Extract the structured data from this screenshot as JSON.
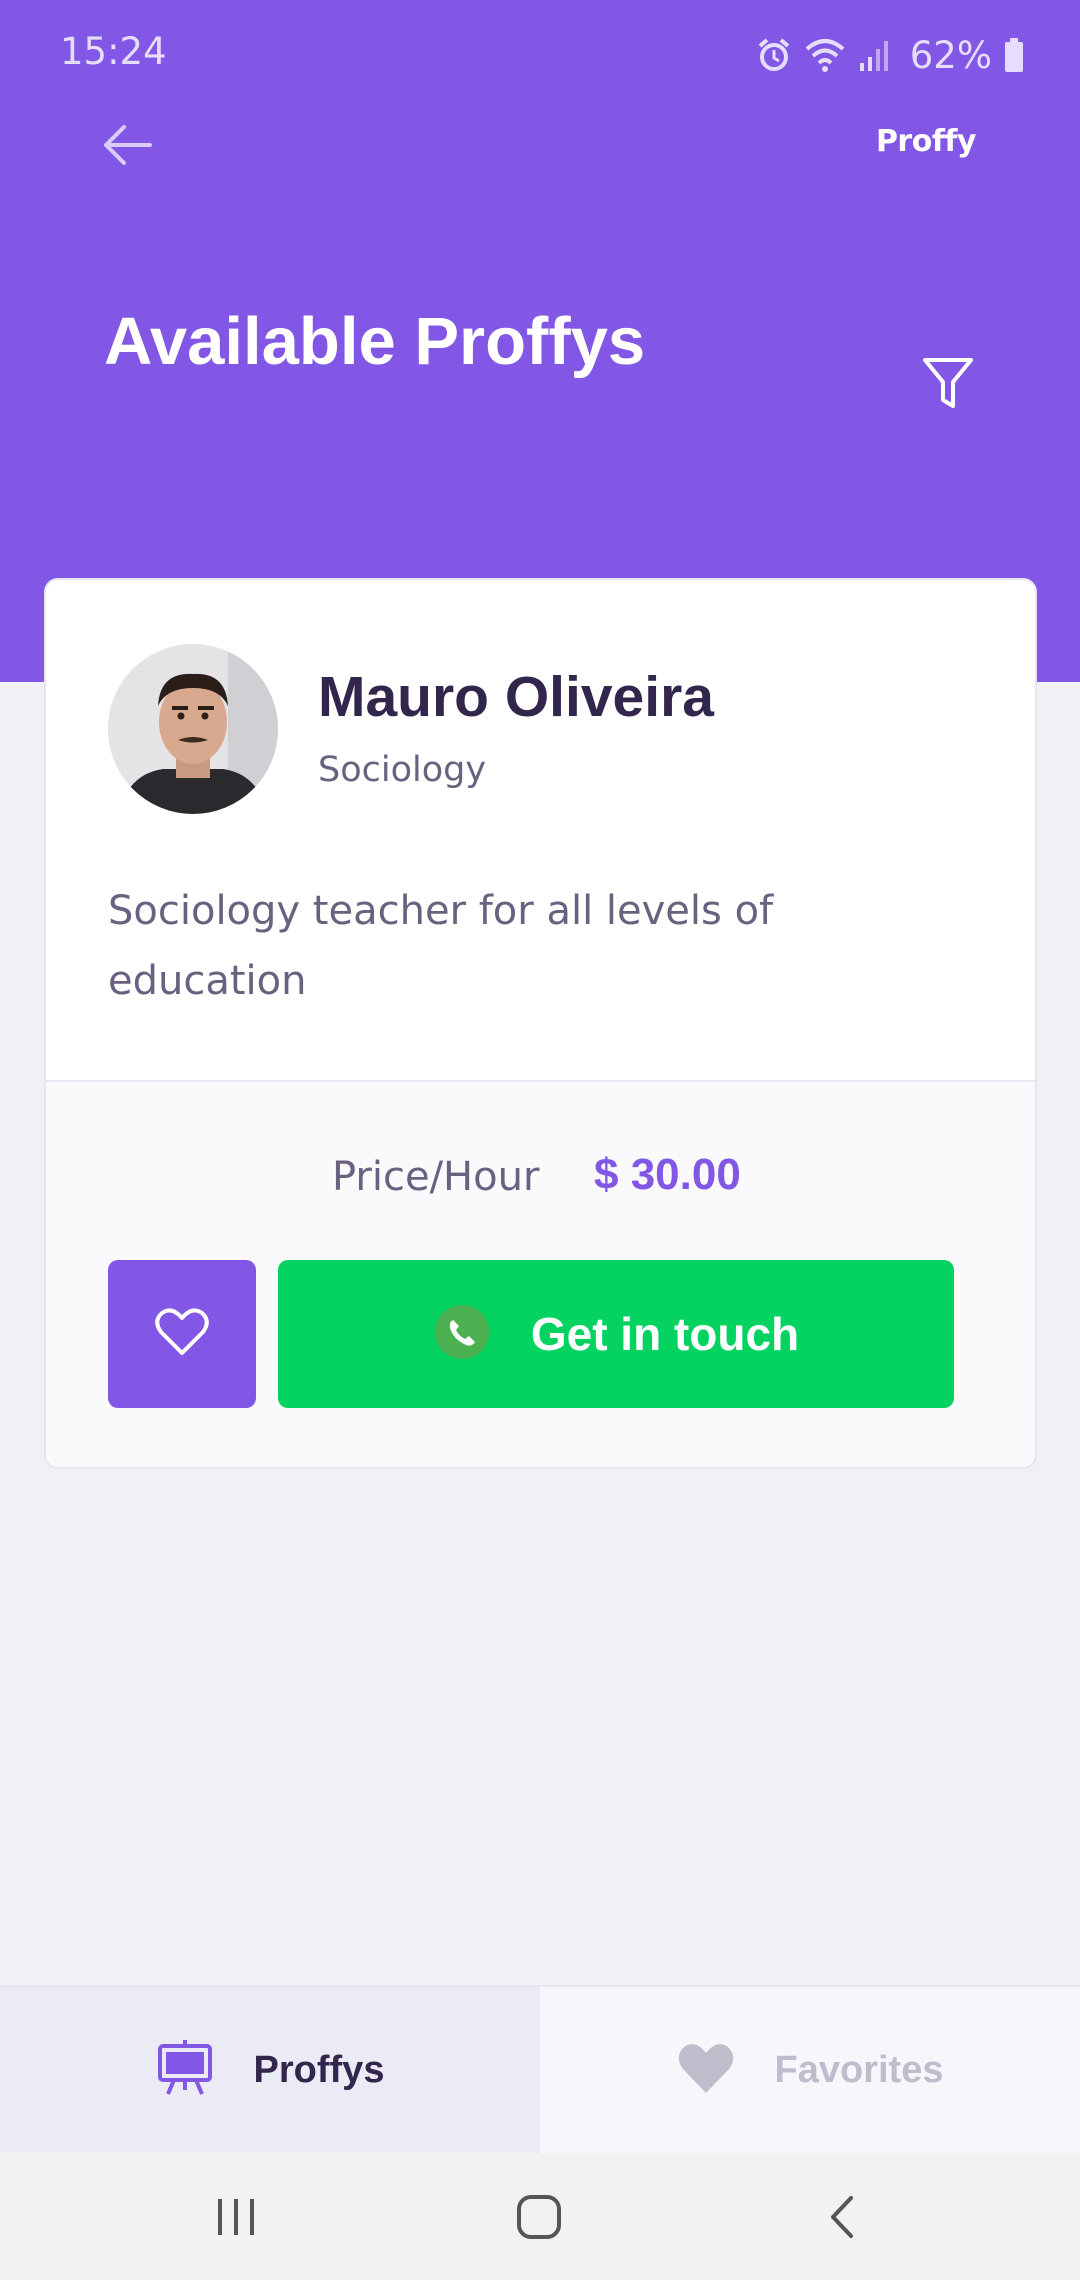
{
  "status_bar": {
    "time": "15:24",
    "battery": "62%",
    "icons": [
      "alarm-icon",
      "wifi-icon",
      "signal-icon",
      "battery-icon"
    ]
  },
  "header": {
    "brand": "Proffy",
    "title": "Available Proffys",
    "icons": [
      "back-arrow-icon",
      "filter-icon"
    ]
  },
  "teacher_card": {
    "name": "Mauro Oliveira",
    "subject": "Sociology",
    "bio": "Sociology teacher for all levels of education",
    "price_label": "Price/Hour",
    "price_value": "$ 30.00",
    "contact_label": "Get in touch",
    "icons": [
      "heart-outline-icon",
      "whatsapp-icon"
    ]
  },
  "tabs": [
    {
      "label": "Proffys",
      "icon": "easel-icon",
      "active": true
    },
    {
      "label": "Favorites",
      "icon": "heart-icon",
      "active": false
    }
  ],
  "system_nav": [
    "recents-icon",
    "home-icon",
    "back-icon"
  ],
  "colors": {
    "primary": "#8257E5",
    "green": "#04D361",
    "title_dark": "#32264D",
    "text": "#6A6180",
    "background": "#F0F0F7"
  }
}
